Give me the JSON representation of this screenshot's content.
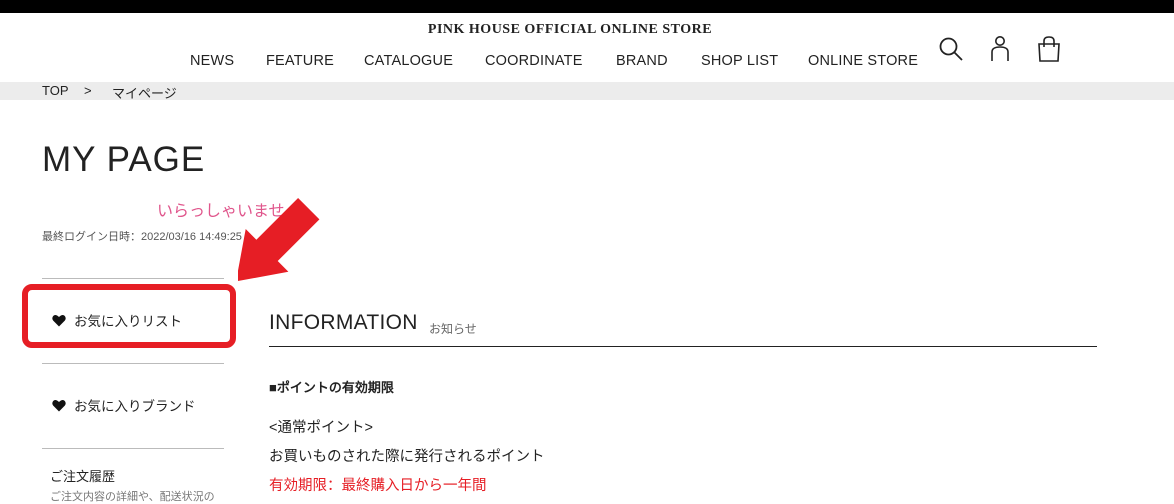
{
  "header": {
    "store_title": "PINK HOUSE OFFICIAL ONLINE STORE",
    "nav": [
      "NEWS",
      "FEATURE",
      "CATALOGUE",
      "COORDINATE",
      "BRAND",
      "SHOP LIST",
      "ONLINE STORE"
    ],
    "icons": [
      "search-icon",
      "user-icon",
      "shopping-bag-icon"
    ]
  },
  "breadcrumb": {
    "items": [
      "TOP",
      "マイページ"
    ],
    "separator": ">"
  },
  "main": {
    "title": "MY PAGE",
    "welcome": "いらっしゃいませ",
    "last_login": "最終ログイン日時：2022/03/16 14:49:25"
  },
  "sidebar": {
    "items": [
      {
        "label": "お気に入りリスト",
        "icon": "heart-icon"
      },
      {
        "label": "お気に入りブランド",
        "icon": "heart-icon"
      }
    ],
    "order_history": {
      "label": "ご注文履歴",
      "sub": "ご注文内容の詳細や、配送状況の"
    }
  },
  "info": {
    "title": "INFORMATION",
    "subtitle": "お知らせ",
    "heading": "■ポイントの有効期限",
    "lines": [
      "<通常ポイント>",
      "お買いものされた際に発行されるポイント",
      "有効期限：最終購入日から一年間"
    ]
  },
  "colors": {
    "highlight": "#e61e25",
    "welcome": "#e0568c",
    "topbar": "#000000",
    "breadcrumb_bg": "#ececec"
  }
}
